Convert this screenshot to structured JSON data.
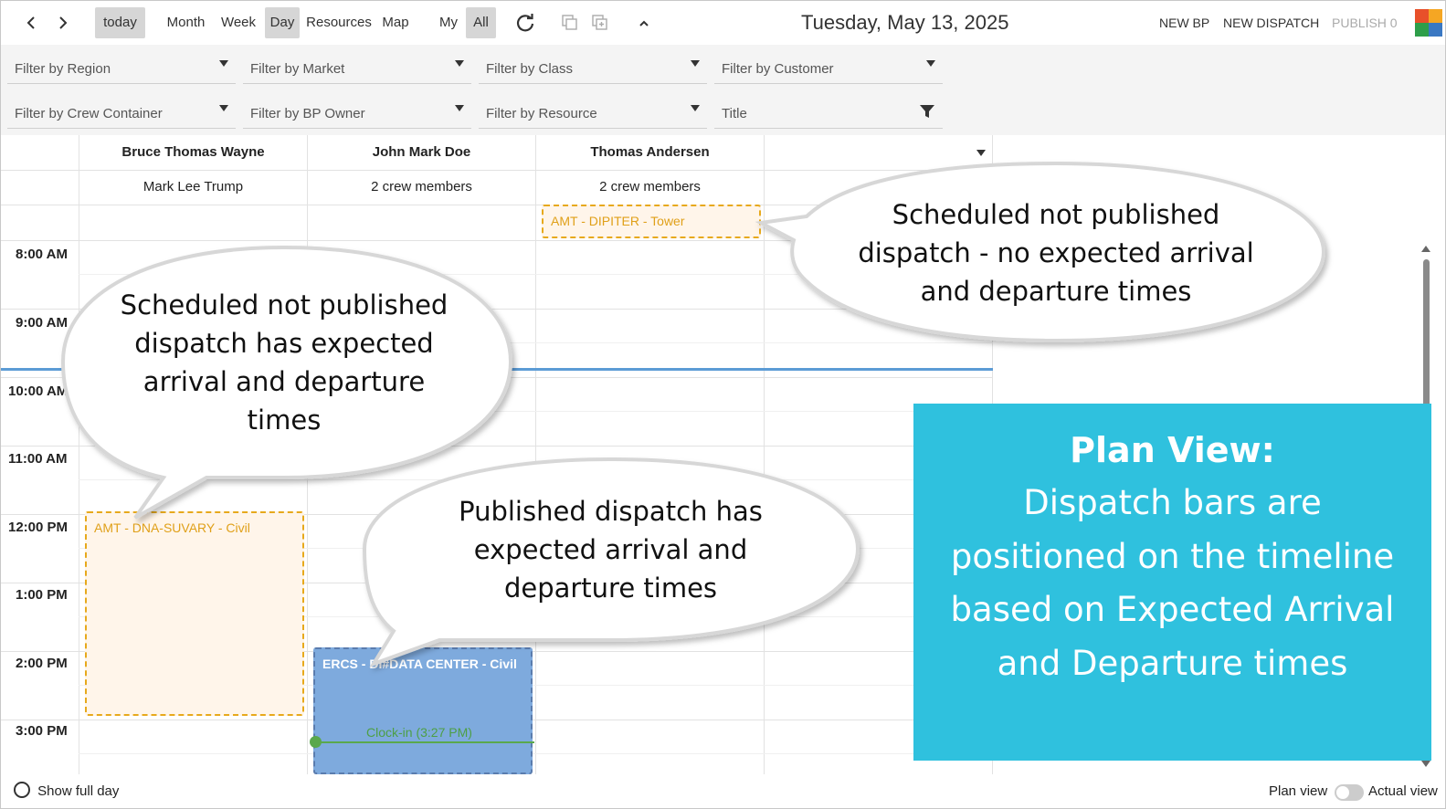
{
  "toolbar": {
    "prev_icon": "chevron-left-icon",
    "next_icon": "chevron-right-icon",
    "today": "today",
    "views": [
      "Month",
      "Week",
      "Day",
      "Resources",
      "Map"
    ],
    "active_view": "Day",
    "scope": [
      "My",
      "All"
    ],
    "active_scope": "All",
    "refresh_icon": "refresh-icon",
    "copy_icon": "copy-icon",
    "add_copy_icon": "add-copy-icon",
    "collapse_icon": "chevron-up-icon",
    "date_title": "Tuesday, May 13, 2025",
    "new_bp": "NEW BP",
    "new_dispatch": "NEW DISPATCH",
    "publish": "PUBLISH 0"
  },
  "filters": {
    "region": "Filter by Region",
    "market": "Filter by Market",
    "class": "Filter by Class",
    "customer": "Filter by Customer",
    "crew_container": "Filter by Crew Container",
    "bp_owner": "Filter by BP Owner",
    "resource": "Filter by Resource",
    "title": "Title"
  },
  "columns": [
    {
      "name": "Bruce Thomas Wayne",
      "sub": "Mark Lee Trump"
    },
    {
      "name": "John Mark Doe",
      "sub": "2 crew members"
    },
    {
      "name": "Thomas Andersen",
      "sub": "2 crew members"
    },
    {
      "name": "",
      "sub": ""
    }
  ],
  "times": [
    "8:00 AM",
    "9:00 AM",
    "10:00 AM",
    "11:00 AM",
    "12:00 PM",
    "1:00 PM",
    "2:00 PM",
    "3:00 PM"
  ],
  "events": {
    "dipiter": "AMT - DIPITER - Tower",
    "suvary": "AMT - DNA-SUVARY - Civil",
    "ercs": "ERCS - DI#DATA CENTER - Civil",
    "clockin": "Clock-in (3:27 PM)"
  },
  "callouts": {
    "top_right": [
      "Scheduled not published",
      "dispatch - no expected arrival",
      "and departure times"
    ],
    "left": [
      "Scheduled not published",
      "dispatch has expected",
      "arrival and departure",
      "times"
    ],
    "middle": [
      "Published dispatch has",
      "expected arrival and",
      "departure times"
    ]
  },
  "plan_box": {
    "title": "Plan View:",
    "lines": [
      "Dispatch bars are",
      "positioned on the timeline",
      "based on Expected Arrival",
      "and Departure times"
    ]
  },
  "bottom": {
    "show_full_day": "Show full day",
    "plan_view": "Plan view",
    "actual_view": "Actual view"
  },
  "colors": {
    "scheduled_border": "#e7a91c",
    "scheduled_fill": "#fff5ea",
    "published_fill": "#7eaadd",
    "now_line": "#5b9bd5",
    "clockin": "#5aa84c",
    "plan_box": "#2fc1de"
  }
}
